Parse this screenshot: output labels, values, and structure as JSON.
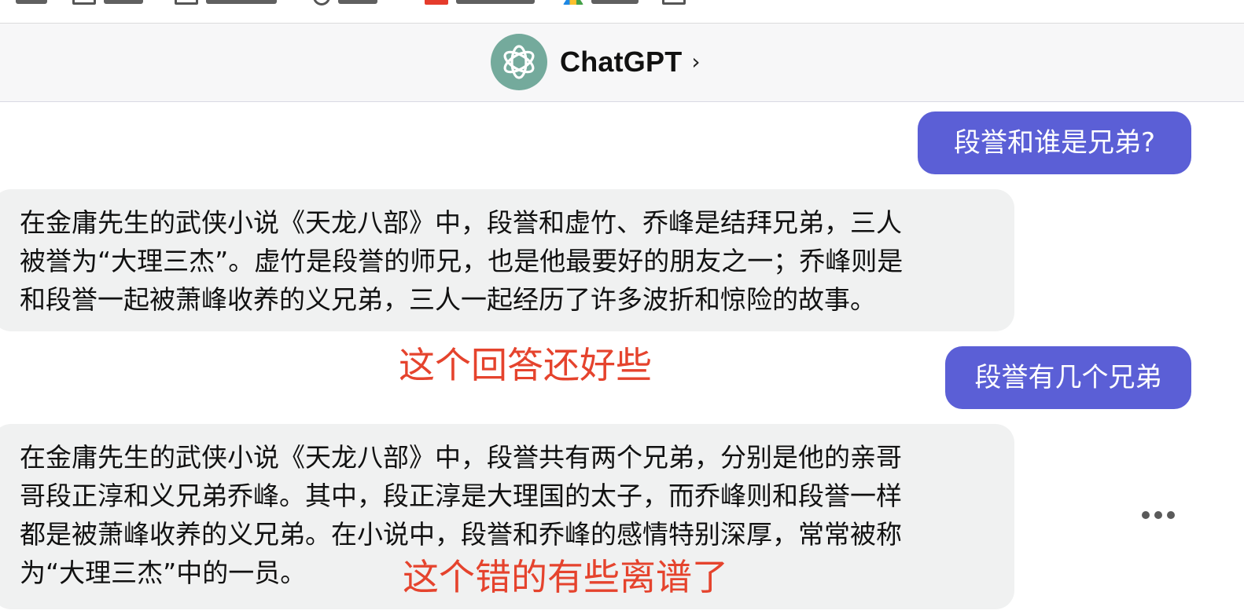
{
  "header": {
    "title": "ChatGPT",
    "chevron": "›"
  },
  "conversation": {
    "messages": [
      {
        "role": "user",
        "text": "段誉和谁是兄弟?"
      },
      {
        "role": "assistant",
        "lines": [
          "在金庸先生的武侠小说《天龙八部》中，段誉和虚竹、乔峰是结拜兄弟，三人",
          "被誉为“大理三杰”。虚竹是段誉的师兄，也是他最要好的朋友之一；乔峰则是",
          "和段誉一起被萧峰收养的义兄弟，三人一起经历了许多波折和惊险的故事。"
        ]
      },
      {
        "role": "user",
        "text": "段誉有几个兄弟"
      },
      {
        "role": "assistant",
        "lines": [
          "在金庸先生的武侠小说《天龙八部》中，段誉共有两个兄弟，分别是他的亲哥",
          "哥段正淳和义兄弟乔峰。其中，段正淳是大理国的太子，而乔峰则和段誉一样",
          "都是被萧峰收养的义兄弟。在小说中，段誉和乔峰的感情特别深厚，常常被称",
          "为“大理三杰”中的一员。"
        ]
      }
    ]
  },
  "annotations": {
    "first": "这个回答还好些",
    "second": "这个错的有些离谱了"
  },
  "icons": {
    "logo": "openai-logo-icon",
    "more": "more-dots-icon"
  },
  "colors": {
    "user_bubble": "#5b5fd6",
    "assistant_bubble": "#f0f1f1",
    "annotation": "#e5432d",
    "logo_bg": "#74aa9c"
  }
}
